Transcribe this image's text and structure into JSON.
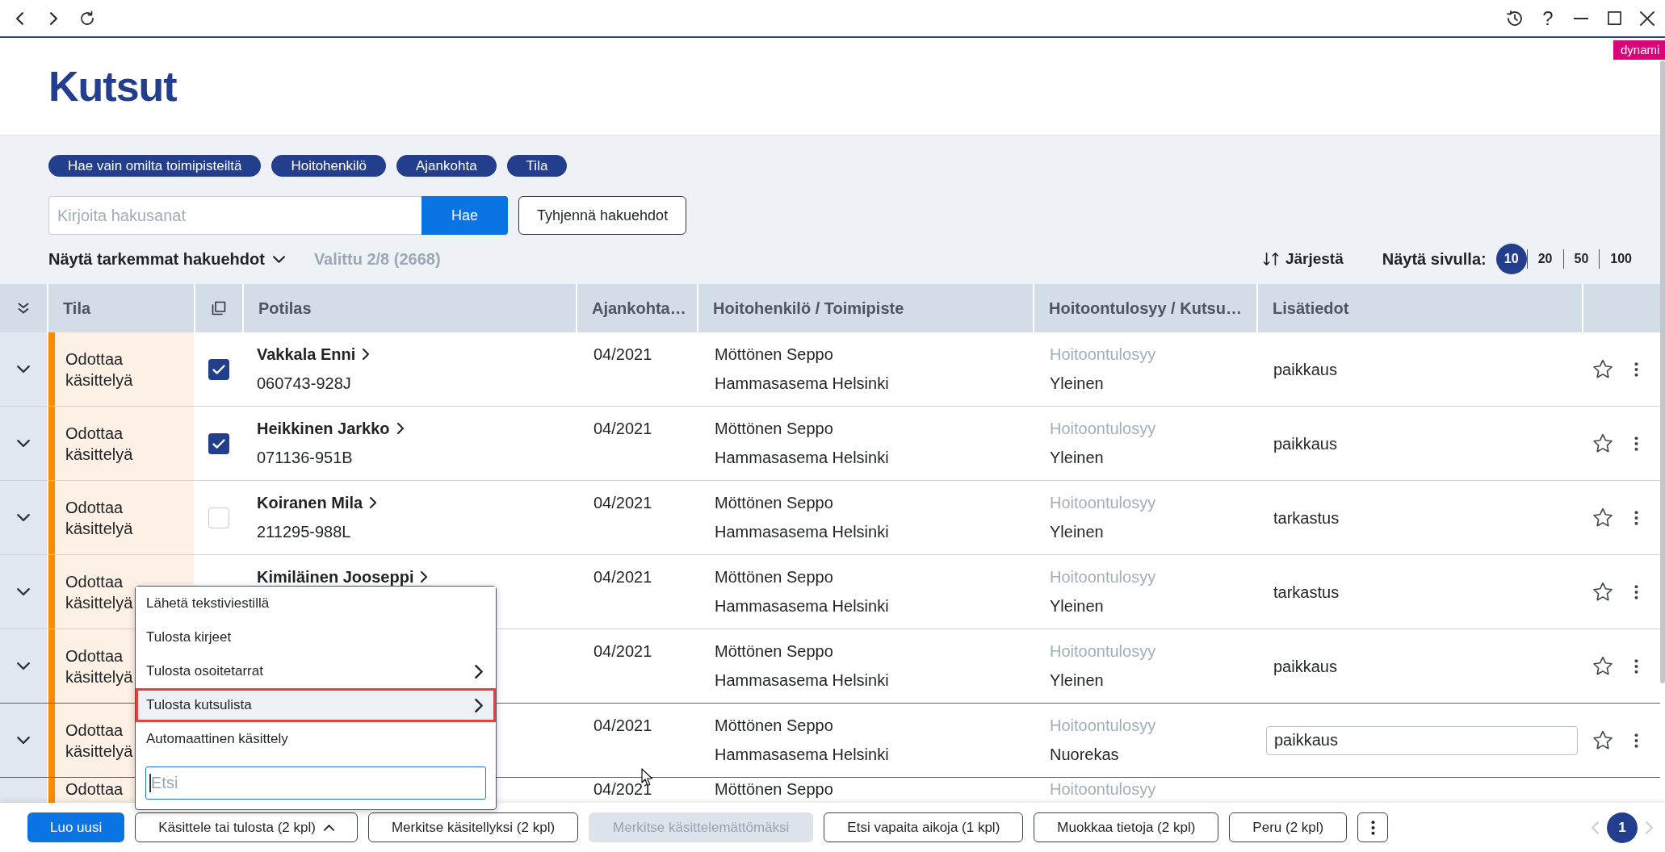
{
  "browser_bar": {
    "help_label": "?",
    "environment_badge": "dynami"
  },
  "page": {
    "title": "Kutsut"
  },
  "filters": {
    "chips": [
      {
        "label": "Hae vain omilta toimipisteiltä"
      },
      {
        "label": "Hoitohenkilö"
      },
      {
        "label": "Ajankohta"
      },
      {
        "label": "Tila"
      }
    ],
    "search": {
      "placeholder": "Kirjoita hakusanat",
      "button": "Hae"
    },
    "clear_button": "Tyhjennä hakuehdot",
    "advanced_toggle": {
      "label": "Näytä tarkemmat hakuehdot",
      "expanded": false
    },
    "selection_info": "Valittu 2/8 (2668)"
  },
  "list_tools": {
    "sort_button": "Järjestä",
    "page_size_label": "Näytä sivulla:",
    "page_sizes": [
      {
        "label": "10",
        "selected": true
      },
      {
        "label": "20",
        "selected": false
      },
      {
        "label": "50",
        "selected": false
      },
      {
        "label": "100",
        "selected": false
      }
    ]
  },
  "table": {
    "columns": [
      "Tila",
      "Potilas",
      "Ajankohta…",
      "Hoitohenkilö / Toimipiste",
      "Hoitoontulosyy / Kutsu…",
      "Lisätiedot"
    ],
    "rows": [
      {
        "expanded": false,
        "status": "Odottaa käsittelyä",
        "checked": true,
        "patient": {
          "name": "Vakkala Enni",
          "id": "060743-928J"
        },
        "date": "04/2021",
        "staff": "Möttönen Seppo",
        "clinic": "Hammasasema Helsinki",
        "reason_label": "Hoitoontulosyy",
        "reason": "Yleinen",
        "notes": "paikkaus",
        "editing": false,
        "starred": false
      },
      {
        "expanded": false,
        "status": "Odottaa käsittelyä",
        "checked": true,
        "patient": {
          "name": "Heikkinen Jarkko",
          "id": "071136-951B"
        },
        "date": "04/2021",
        "staff": "Möttönen Seppo",
        "clinic": "Hammasasema Helsinki",
        "reason_label": "Hoitoontulosyy",
        "reason": "Yleinen",
        "notes": "paikkaus",
        "editing": false,
        "starred": false
      },
      {
        "expanded": false,
        "status": "Odottaa käsittelyä",
        "checked": false,
        "patient": {
          "name": "Koiranen Mila",
          "id": "211295-988L"
        },
        "date": "04/2021",
        "staff": "Möttönen Seppo",
        "clinic": "Hammasasema Helsinki",
        "reason_label": "Hoitoontulosyy",
        "reason": "Yleinen",
        "notes": "tarkastus",
        "editing": false,
        "starred": false
      },
      {
        "expanded": false,
        "status": "Odottaa käsittelyä",
        "patient": {
          "name": "Kimiläinen Jooseppi"
        },
        "date": "04/2021",
        "staff": "Möttönen Seppo",
        "clinic": "Hammasasema Helsinki",
        "reason_label": "Hoitoontulosyy",
        "reason": "Yleinen",
        "notes": "tarkastus",
        "editing": false,
        "starred": false
      },
      {
        "expanded": false,
        "status": "Odottaa käsittelyä",
        "date": "04/2021",
        "staff": "Möttönen Seppo",
        "clinic": "Hammasasema Helsinki",
        "reason_label": "Hoitoontulosyy",
        "reason": "Yleinen",
        "notes": "paikkaus",
        "editing": false,
        "starred": false
      },
      {
        "expanded": false,
        "status": "Odottaa käsittelyä",
        "date": "04/2021",
        "staff": "Möttönen Seppo",
        "clinic": "Hammasasema Helsinki",
        "reason_label": "Hoitoontulosyy",
        "reason": "Nuorekas",
        "notes": "paikkaus",
        "editing": true,
        "starred": false
      },
      {
        "status": "Odottaa",
        "date": "04/2021",
        "staff": "Möttönen Seppo",
        "reason_label": "Hoitoontulosyy"
      }
    ]
  },
  "context_menu": {
    "items": [
      {
        "label": "Lähetä tekstiviestillä",
        "submenu": false,
        "selected": false
      },
      {
        "label": "Tulosta kirjeet",
        "submenu": false,
        "selected": false
      },
      {
        "label": "Tulosta osoitetarrat",
        "submenu": true,
        "selected": false
      },
      {
        "label": "Tulosta kutsulista",
        "submenu": true,
        "selected": true
      },
      {
        "label": "Automaattinen käsittely",
        "submenu": false,
        "selected": false
      }
    ],
    "search": {
      "placeholder": "Etsi"
    }
  },
  "action_bar": {
    "buttons": [
      {
        "kind": "primary",
        "label": "Luo uusi",
        "disabled": false
      },
      {
        "kind": "menu",
        "label": "Käsittele tai tulosta (2 kpl)",
        "expanded": true,
        "disabled": false
      },
      {
        "kind": "secondary",
        "label": "Merkitse käsitellyksi (2 kpl)",
        "disabled": false
      },
      {
        "kind": "secondary",
        "label": "Merkitse käsittelemättömäksi",
        "disabled": true
      },
      {
        "kind": "secondary",
        "label": "Etsi vapaita aikoja (1 kpl)",
        "disabled": false
      },
      {
        "kind": "secondary",
        "label": "Muokkaa tietoja (2 kpl)",
        "disabled": false
      },
      {
        "kind": "secondary",
        "label": "Peru (2 kpl)",
        "disabled": false
      },
      {
        "kind": "more",
        "disabled": false
      }
    ],
    "pagination": {
      "previous": {
        "disabled": true
      },
      "pages": [
        {
          "label": "1",
          "selected": true
        }
      ],
      "next": {
        "disabled": true
      }
    }
  }
}
